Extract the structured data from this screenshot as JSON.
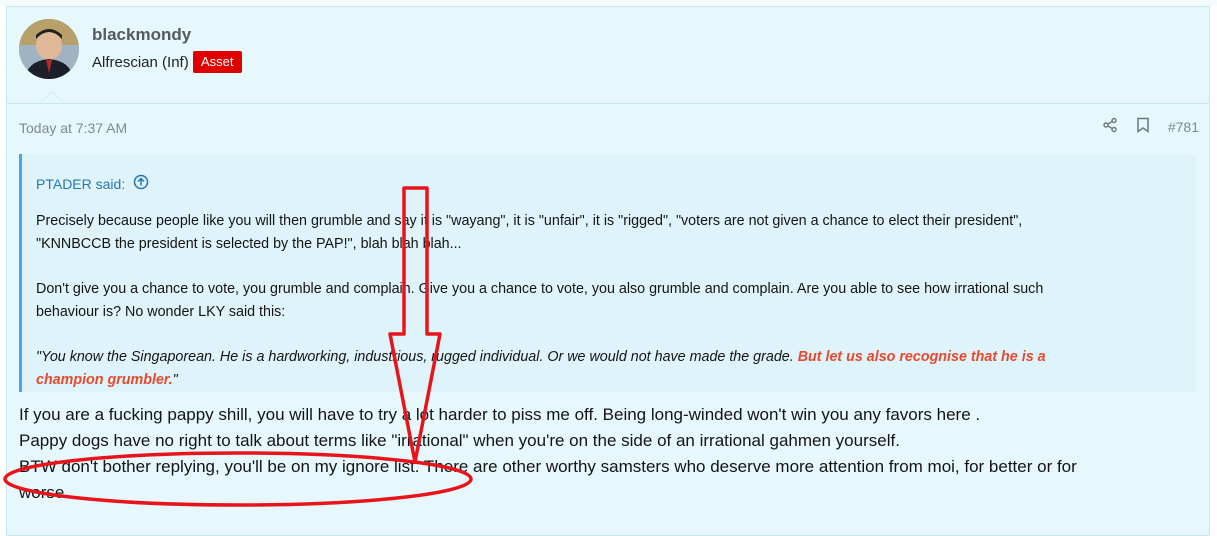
{
  "post": {
    "username": "blackmondy",
    "user_title": "Alfrescian (Inf)",
    "badge": "Asset",
    "date": "Today at 7:37 AM",
    "post_number": "#781",
    "icons": {
      "share": "share-icon",
      "bookmark": "bookmark-icon",
      "quote_expand": "arrow-up-circle-icon"
    }
  },
  "quote": {
    "author": "PTADER said:",
    "para1_line1": "Precisely because people like you will then grumble and say it is \"wayang\", it is \"unfair\", it is \"rigged\", \"voters are not given a chance to elect their president\",",
    "para1_line2": "\"KNNBCCB the president is selected by the PAP!\", blah blah blah...",
    "para2_line1": "Don't give you a chance to vote, you grumble and complain. Give you a chance to vote, you also grumble and complain. Are you able to see how irrational such",
    "para2_line2": "behaviour is? No wonder LKY said this:",
    "lky_plain": "\"You know the Singaporean. He is a hardworking, industrious, rugged individual. Or we would not have made the grade. ",
    "lky_emph_line1": "But let us also recognise that he is a",
    "lky_emph_line2": "champion grumbler.",
    "lky_close": "\""
  },
  "body": {
    "line1": "If you are a fucking pappy shill, you will have to try a lot harder to piss me off. Being long-winded won't win you any favors here .",
    "line2": "Pappy dogs have no right to talk about terms like \"irrational\" when you're on the side of an irrational gahmen yourself.",
    "line3": "BTW don't bother replying, you'll be on my ignore list. There are other worthy samsters who deserve more attention from moi, for better or for",
    "line4": "worse."
  },
  "colors": {
    "post_bg": "#e7f8fc",
    "quote_bg": "#dff3fa",
    "quote_border": "#47a7eb",
    "badge": "#e00000",
    "emphasis": "#e6492d",
    "annotation": "#e8141c"
  }
}
